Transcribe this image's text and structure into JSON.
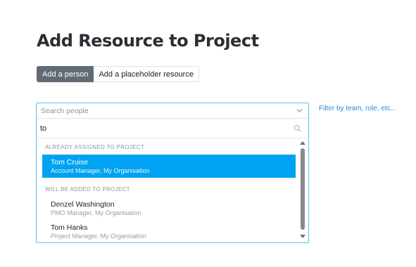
{
  "page": {
    "title": "Add Resource to Project"
  },
  "mode_toggle": {
    "person_label": "Add a person",
    "placeholder_label": "Add a placeholder resource",
    "selected": "Add a person"
  },
  "picker": {
    "placeholder": "Search people",
    "search_value": "to",
    "groups": [
      {
        "heading": "ALREADY ASSIGNED TO PROJECT",
        "options": [
          {
            "name": "Tom Cruise",
            "subtitle": "Account Manager, My Organisation",
            "selected": true
          }
        ]
      },
      {
        "heading": "WILL BE ADDED TO PROJECT",
        "options": [
          {
            "name": "Denzel Washington",
            "subtitle": "PMO Manager, My Organisation",
            "selected": false
          },
          {
            "name": "Tom Hanks",
            "subtitle": "Project Manager, My Organisation",
            "selected": false
          }
        ]
      }
    ]
  },
  "filter_link": "Filter by team, role, etc...",
  "colors": {
    "accent": "#00a2f1",
    "focus_border": "#55c3f0",
    "active_toggle": "#616b76",
    "link": "#2a8bd8"
  },
  "icons": [
    "chevron-down-icon",
    "search-icon",
    "scroll-up-icon",
    "scroll-down-icon"
  ]
}
